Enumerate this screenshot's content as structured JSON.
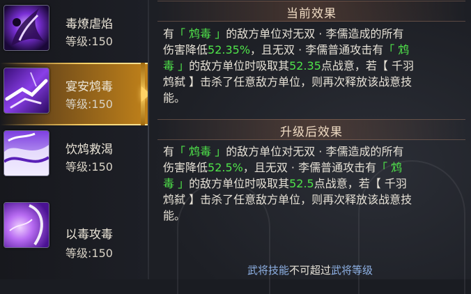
{
  "skills": [
    {
      "name": "毒燎虐焰",
      "level": "等级:150",
      "selected": false
    },
    {
      "name": "宴安鸩毒",
      "level": "等级:150",
      "selected": true
    },
    {
      "name": "饮鸩救渴",
      "level": "等级:150",
      "selected": false
    },
    {
      "name": "以毒攻毒",
      "level": "等级:150",
      "selected": false
    }
  ],
  "current": {
    "title": "当前效果",
    "line1": [
      "有",
      "「 鸩毒 」",
      "的敌方单位对无双 · 李儒造成的所有"
    ],
    "line2": [
      "伤害降低",
      "52.35%",
      "，且无双 · 李儒普通攻击有",
      "「 鸩"
    ],
    "line3": [
      "毒 」",
      "的敌方单位时吸取其",
      "52.35",
      "点战意，若【 千羽"
    ],
    "line4": "鸩弑 】击杀了任意敌方单位，则再次释放该战意技",
    "line5": "能。"
  },
  "upgraded": {
    "title": "升级后效果",
    "line1": [
      "有",
      "「 鸩毒 」",
      "的敌方单位对无双 · 李儒造成的所有"
    ],
    "line2": [
      "伤害降低",
      "52.5%",
      "，且无双 · 李儒普通攻击有",
      "「 鸩"
    ],
    "line3": [
      "毒 」",
      "的敌方单位时吸取其",
      "52.5",
      "点战意，若【 千羽"
    ],
    "line4": "鸩弑 】击杀了任意敌方单位，则再次释放该战意技",
    "line5": "能。"
  },
  "footer": {
    "part1": "武将技能",
    "part2": "不可超过",
    "part3": "武将等级"
  },
  "colors": {
    "highlight_green": "#4fe34a",
    "selected_gold": "#f7c956",
    "footer_blue": "#8fb2e6"
  }
}
